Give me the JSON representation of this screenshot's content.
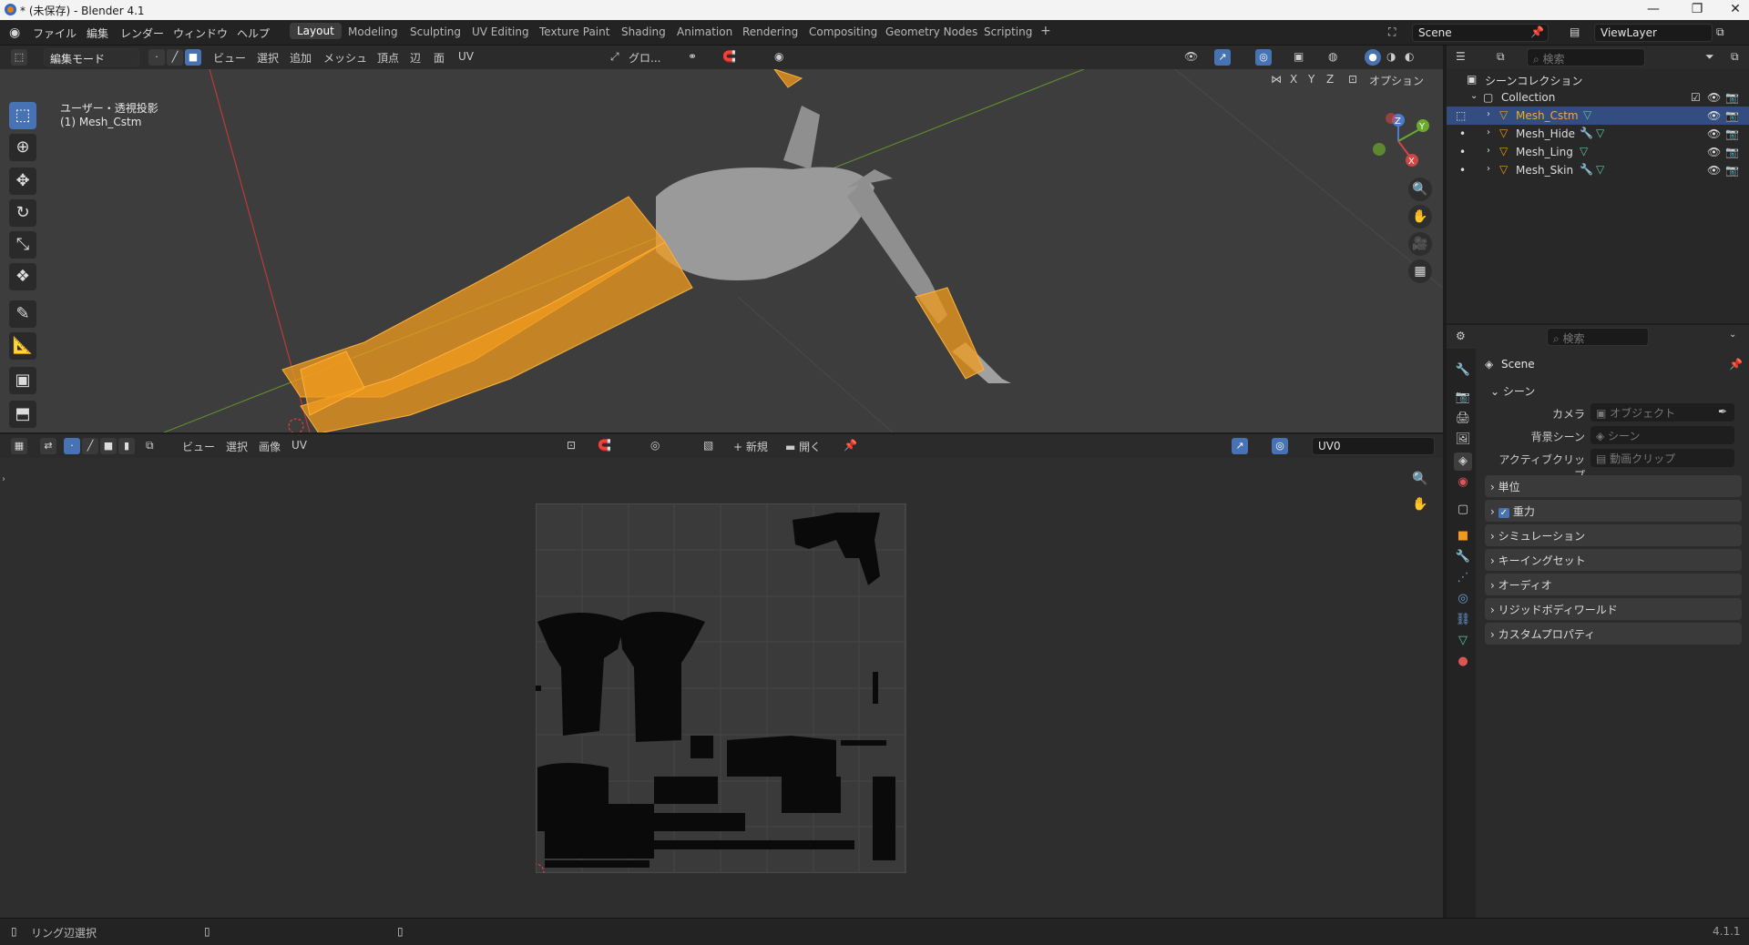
{
  "window": {
    "title": "* (未保存) - Blender 4.1",
    "controls": [
      "—",
      "❐",
      "✕"
    ]
  },
  "menubar": {
    "items": [
      "ファイル",
      "編集",
      "レンダー",
      "ウィンドウ",
      "ヘルプ"
    ]
  },
  "workspaces": {
    "tabs": [
      "Layout",
      "Modeling",
      "Sculpting",
      "UV Editing",
      "Texture Paint",
      "Shading",
      "Animation",
      "Rendering",
      "Compositing",
      "Geometry Nodes",
      "Scripting"
    ],
    "active": "Layout",
    "add": "+"
  },
  "scene": {
    "name": "Scene",
    "viewlayer": "ViewLayer"
  },
  "viewport": {
    "mode": "編集モード",
    "menus": [
      "ビュー",
      "選択",
      "追加",
      "メッシュ",
      "頂点",
      "辺",
      "面",
      "UV"
    ],
    "transform": "グロ...",
    "axes": [
      "X",
      "Y",
      "Z"
    ],
    "options": "オプション",
    "overlay_title": "ユーザー・透視投影",
    "overlay_object": "(1) Mesh_Cstm",
    "gizmo": {
      "z": "Z",
      "y": "Y",
      "x": "X"
    }
  },
  "uv_editor": {
    "menus": [
      "ビュー",
      "選択",
      "画像",
      "UV"
    ],
    "new_label": "新規",
    "open_label": "開く",
    "uvmap": "UV0"
  },
  "outliner": {
    "search_placeholder": "検索",
    "root": "シーンコレクション",
    "collection": "Collection",
    "objects": [
      {
        "name": "Mesh_Cstm",
        "selected": true
      },
      {
        "name": "Mesh_Hide",
        "selected": false
      },
      {
        "name": "Mesh_Ling",
        "selected": false
      },
      {
        "name": "Mesh_Skin",
        "selected": false
      }
    ]
  },
  "properties": {
    "search_placeholder": "検索",
    "context": "Scene",
    "section": "シーン",
    "fields": [
      {
        "label": "カメラ",
        "value": "オブジェクト"
      },
      {
        "label": "背景シーン",
        "value": "シーン"
      },
      {
        "label": "アクティブクリップ",
        "value": "動画クリップ"
      }
    ],
    "panels": [
      "単位",
      "重力",
      "シミュレーション",
      "キーイングセット",
      "オーディオ",
      "リジッドボディワールド",
      "カスタムプロパティ"
    ],
    "gravity_checked": true
  },
  "statusbar": {
    "left": "リング辺選択",
    "version": "4.1.1"
  }
}
